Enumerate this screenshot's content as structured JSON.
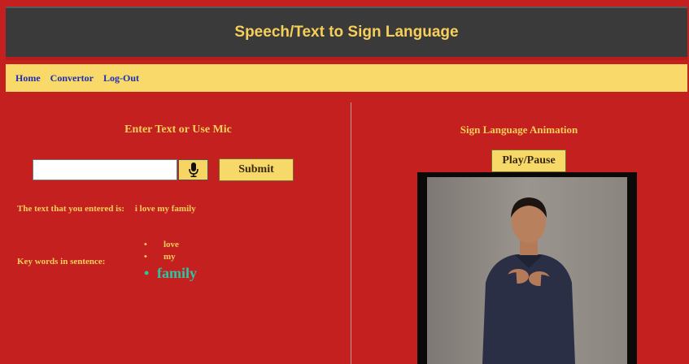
{
  "header": {
    "title": "Speech/Text to Sign Language"
  },
  "nav": {
    "items": [
      "Home",
      "Convertor",
      "Log-Out"
    ]
  },
  "left": {
    "title": "Enter Text or Use Mic",
    "input_value": "",
    "mic_icon": "microphone-icon",
    "submit_label": "Submit",
    "entered_label": "The text that you entered is:",
    "entered_value": "i love my family",
    "keywords_label": "Key words in sentence:",
    "keywords": [
      "love",
      "my",
      "family"
    ],
    "active_keyword_index": 2
  },
  "right": {
    "title": "Sign Language Animation",
    "play_label": "Play/Pause",
    "video_icon": "signer-video"
  },
  "colors": {
    "background": "#c3201f",
    "header_bg": "#3a3a3a",
    "accent_yellow": "#f6cf5a",
    "nav_bg": "#f9d96a",
    "nav_link": "#1b2fb0",
    "active_keyword": "#2ec4a6"
  }
}
